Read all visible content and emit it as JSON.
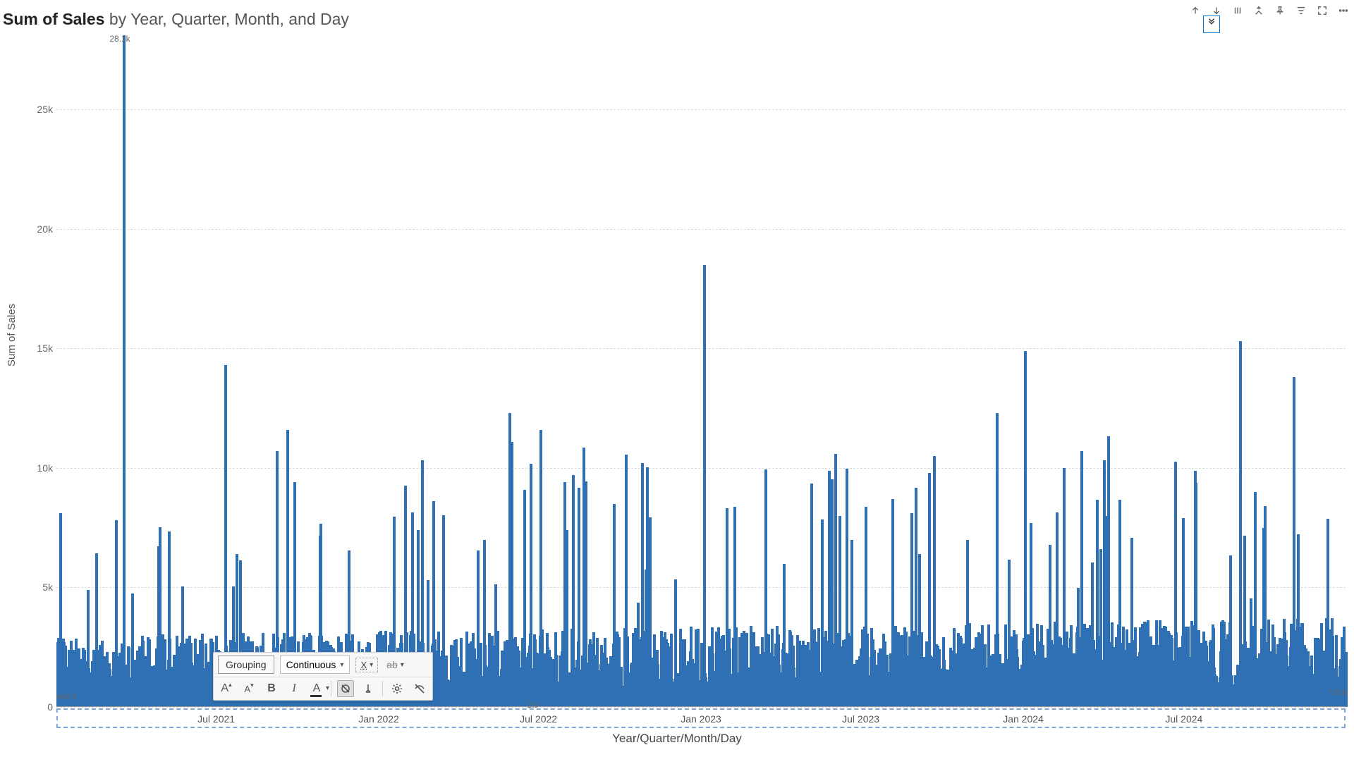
{
  "chart_title_bold": "Sum of Sales",
  "chart_title_rest": " by Year, Quarter, Month, and Day",
  "y_axis_label": "Sum of Sales",
  "x_axis_label": "Year/Quarter/Month/Day",
  "y_ticks": [
    "0",
    "5k",
    "10k",
    "15k",
    "20k",
    "25k"
  ],
  "y_tick_values": [
    0,
    5000,
    10000,
    15000,
    20000,
    25000
  ],
  "x_ticks": [
    "Jul 2021",
    "Jan 2022",
    "Jul 2022",
    "Jan 2023",
    "Jul 2023",
    "Jan 2024",
    "Jul 2024"
  ],
  "peak_label": "28.1k",
  "min_label": "468.9",
  "right_label": "713.8",
  "axis_small_label": "2.9",
  "toolbar": {
    "grouping": "Grouping",
    "continuous": "Continuous",
    "x_label": "X",
    "ab_label": "ab",
    "font_inc": "A",
    "font_dec": "A",
    "bold": "B",
    "italic": "I",
    "font_color": "A"
  },
  "chart_data": {
    "type": "bar",
    "title": "Sum of Sales by Year, Quarter, Month, and Day",
    "xlabel": "Year/Quarter/Month/Day",
    "ylabel": "Sum of Sales",
    "ylim": [
      0,
      28100
    ],
    "y_ticks": [
      0,
      5000,
      10000,
      15000,
      20000,
      25000
    ],
    "x_tick_labels": [
      "Jul 2021",
      "Jan 2022",
      "Jul 2022",
      "Jan 2023",
      "Jul 2023",
      "Jan 2024",
      "Jul 2024"
    ],
    "x_range": [
      "2021-01-01",
      "2024-12-31"
    ],
    "data_description": "Daily Sum of Sales from Jan 2021 to Dec 2024 (~1460 daily bars). Distribution is dense with most daily totals between ~500 and ~6000, with intermittent spikes.",
    "notable_points": [
      {
        "approx_date": "2021-03",
        "value": 28100,
        "label": "28.1k",
        "note": "global max"
      },
      {
        "approx_date": "2023-01",
        "value": 18500
      },
      {
        "approx_date": "2024-09",
        "value": 15300
      },
      {
        "approx_date": "2024-01",
        "value": 14900
      },
      {
        "approx_date": "2021-07",
        "value": 14300
      },
      {
        "approx_date": "2024-11",
        "value": 13800
      },
      {
        "approx_date": "2022-06",
        "value": 12300
      },
      {
        "approx_date": "2023-12",
        "value": 12300
      },
      {
        "approx_date": "2022-07",
        "value": 11600
      },
      {
        "approx_date": "2021-09",
        "value": 11600
      },
      {
        "approx_date": "2021-08",
        "value": 10700
      },
      {
        "approx_date": "2023-06",
        "value": 10600
      },
      {
        "approx_date": "2024-03",
        "value": 10700
      },
      {
        "approx_date": "2024-02",
        "value": 10000
      }
    ],
    "min_value": 468.9,
    "last_value": 713.8,
    "typical_range": [
      500,
      6000
    ],
    "series_color": "#2e70b3"
  }
}
